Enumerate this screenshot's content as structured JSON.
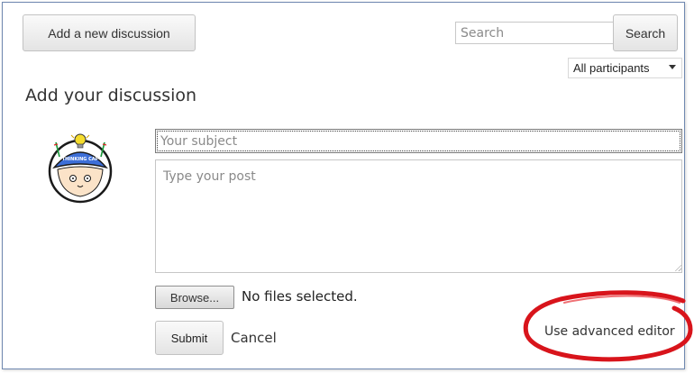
{
  "toolbar": {
    "add_discussion_label": "Add a new discussion",
    "search_placeholder": "Search",
    "search_button_label": "Search",
    "participants_filter": "All participants"
  },
  "form": {
    "heading": "Add your discussion",
    "subject_placeholder": "Your subject",
    "post_placeholder": "Type your post",
    "browse_label": "Browse...",
    "file_status": "No files selected.",
    "submit_label": "Submit",
    "cancel_label": "Cancel",
    "advanced_editor_label": "Use advanced editor"
  },
  "avatar": {
    "cap_text": "THINKING CAP"
  },
  "colors": {
    "frame_border": "#6f88b0",
    "annotation_ring": "#d8141b",
    "cap_blue": "#3d6fd8",
    "bulb_yellow": "#f5dc2c"
  }
}
